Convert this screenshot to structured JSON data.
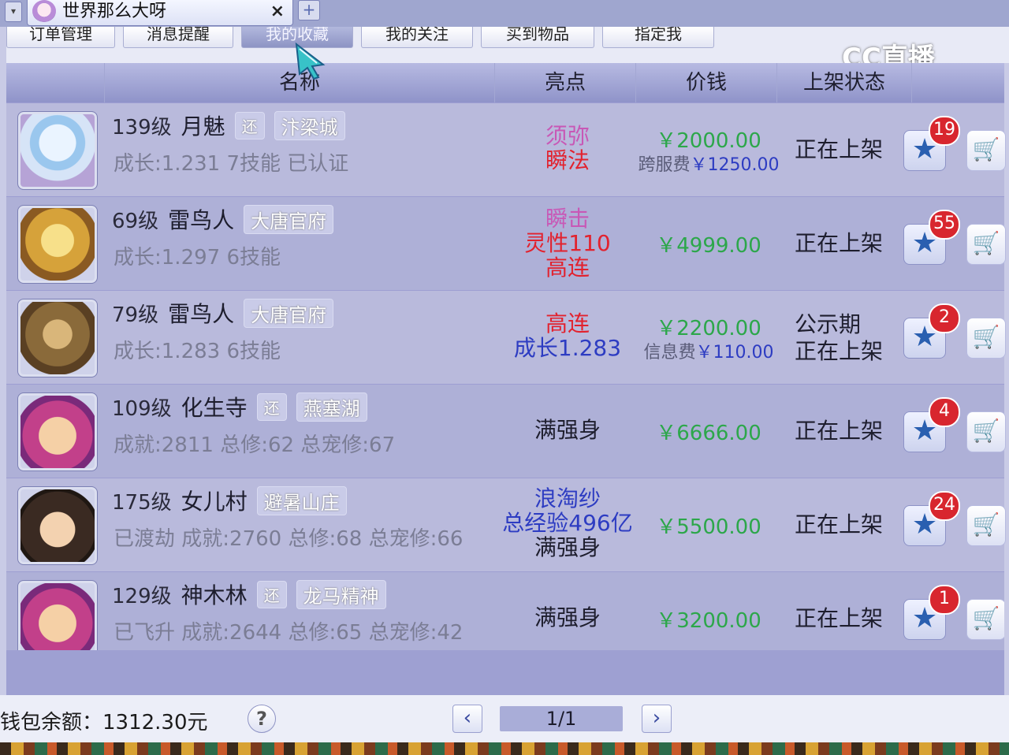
{
  "window": {
    "tab_title": "世界那么大呀",
    "close_glyph": "×",
    "add_glyph": "+",
    "dropdown_glyph": "▾"
  },
  "section_tabs": [
    {
      "label": "订单管理"
    },
    {
      "label": "消息提醒"
    },
    {
      "label": "我的收藏"
    },
    {
      "label": "我的关注"
    },
    {
      "label": "买到物品"
    },
    {
      "label": "指定我"
    }
  ],
  "watermark": "CC直播",
  "columns": {
    "name": "名称",
    "highlight": "亮点",
    "price": "价钱",
    "status": "上架状态"
  },
  "rows": [
    {
      "level": "139级",
      "name": "月魅",
      "tag": "还",
      "server": "汴梁城",
      "detail": "成长:1.231  7技能  已认证",
      "hl": [
        "须弥",
        "瞬法"
      ],
      "price": "￥2000.00",
      "fee": [
        "跨服费",
        "￥1250.00"
      ],
      "status": [
        "正在上架"
      ],
      "fav": "19",
      "star": "★",
      "cart": "🛒"
    },
    {
      "level": "69级",
      "name": "雷鸟人",
      "tag": "",
      "server": "大唐官府",
      "detail": "成长:1.297  6技能",
      "hl": [
        "瞬击",
        "灵性110",
        "高连"
      ],
      "price": "￥4999.00",
      "fee": [
        "",
        ""
      ],
      "status": [
        "正在上架"
      ],
      "fav": "55",
      "star": "★",
      "cart": "🛒"
    },
    {
      "level": "79级",
      "name": "雷鸟人",
      "tag": "",
      "server": "大唐官府",
      "detail": "成长:1.283  6技能",
      "hl": [
        "高连",
        "成长1.283"
      ],
      "price": "￥2200.00",
      "fee": [
        "信息费",
        "￥110.00"
      ],
      "status": [
        "公示期",
        "正在上架"
      ],
      "fav": "2",
      "star": "★",
      "cart": "🛒"
    },
    {
      "level": "109级",
      "name": "化生寺",
      "tag": "还",
      "server": "燕塞湖",
      "detail": "成就:2811  总修:62  总宠修:67",
      "hl": [
        "满强身"
      ],
      "price": "￥6666.00",
      "fee": [
        "",
        ""
      ],
      "status": [
        "正在上架"
      ],
      "fav": "4",
      "star": "★",
      "cart": "🛒"
    },
    {
      "level": "175级",
      "name": "女儿村",
      "tag": "",
      "server": "避暑山庄",
      "detail": "已渡劫  成就:2760  总修:68  总宠修:66",
      "hl": [
        "浪淘纱",
        "总经验496亿",
        "满强身"
      ],
      "price": "￥5500.00",
      "fee": [
        "",
        ""
      ],
      "status": [
        "正在上架"
      ],
      "fav": "24",
      "star": "★",
      "cart": "🛒"
    },
    {
      "level": "129级",
      "name": "神木林",
      "tag": "还",
      "server": "龙马精神",
      "detail": "已飞升  成就:2644  总修:65  总宠修:42",
      "hl": [
        "满强身"
      ],
      "price": "￥3200.00",
      "fee": [
        "",
        ""
      ],
      "status": [
        "正在上架"
      ],
      "fav": "1",
      "star": "★",
      "cart": "🛒"
    }
  ],
  "footer": {
    "balance": "钱包余额：1312.30元",
    "help": "?",
    "prev": "‹",
    "next": "›",
    "page": "1/1"
  },
  "colors": {
    "header": "#9fa3d3",
    "price_green": "#2ca74a",
    "badge_red": "#d8262e",
    "star_blue": "#2a5fb0"
  }
}
